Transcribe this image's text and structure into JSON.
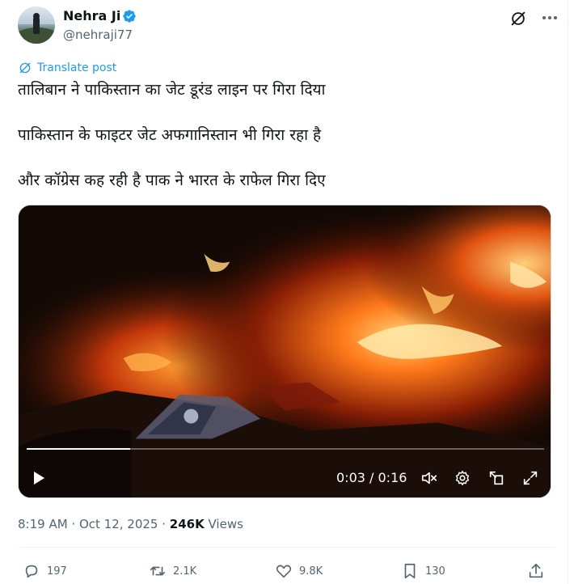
{
  "author": {
    "name": "Nehra Ji",
    "handle": "@nehraji77"
  },
  "translate_label": "Translate post",
  "post": {
    "lines": [
      "तालिबान ने पाकिस्तान का जेट डूरंड लाइन पर गिरा दिया",
      "पाकिस्तान के फाइटर जेट अफगानिस्तान भी गिरा रहा है",
      "और कॉग्रेस कह रही है पाक ने भारत के राफेल गिरा दिए"
    ]
  },
  "video": {
    "time": "0:03 / 0:16",
    "progress_fraction": 0.2
  },
  "meta": {
    "timestamp": "8:19 AM · Oct 12, 2025",
    "sep": " · ",
    "views_count": "246K",
    "views_label": " Views"
  },
  "actions": {
    "replies": "197",
    "reposts": "2.1K",
    "likes": "9.8K",
    "bookmarks": "130"
  },
  "colors": {
    "accent": "#1d9bf0",
    "text": "#0f1419",
    "muted": "#536471"
  }
}
